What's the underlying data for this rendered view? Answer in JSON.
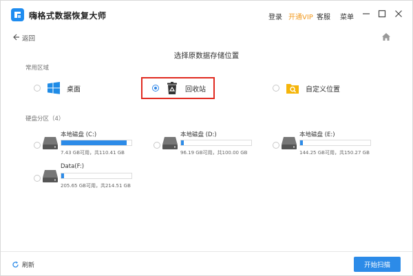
{
  "app": {
    "title": "嗨格式数据恢复大师"
  },
  "header_menu": {
    "login": "登录",
    "vip": "开通VIP",
    "service": "客服",
    "menu": "菜单"
  },
  "nav": {
    "back": "返回"
  },
  "page_title": "选择原数据存储位置",
  "common_section": {
    "label": "常用区域",
    "items": [
      {
        "label": "桌面",
        "icon": "windows-icon",
        "selected": false
      },
      {
        "label": "回收站",
        "icon": "recycle-bin-icon",
        "selected": true
      },
      {
        "label": "自定义位置",
        "icon": "custom-folder-icon",
        "selected": false
      }
    ]
  },
  "disk_section": {
    "label": "硬盘分区（4）",
    "disks": [
      {
        "name": "本地磁盘 (C:)",
        "info": "7.43 GB可用，共110.41 GB",
        "used_fraction": 0.93
      },
      {
        "name": "本地磁盘 (D:)",
        "info": "96.19 GB可用，共100.00 GB",
        "used_fraction": 0.04
      },
      {
        "name": "本地磁盘 (E:)",
        "info": "144.25 GB可用，共150.27 GB",
        "used_fraction": 0.04
      },
      {
        "name": "Data(F:)",
        "info": "205.65 GB可用，共214.51 GB",
        "used_fraction": 0.04
      }
    ]
  },
  "footer": {
    "refresh": "刷新",
    "scan": "开始扫描"
  },
  "colors": {
    "accent": "#2c8be8",
    "vip": "#f29a1f",
    "highlight": "#e0281e"
  }
}
